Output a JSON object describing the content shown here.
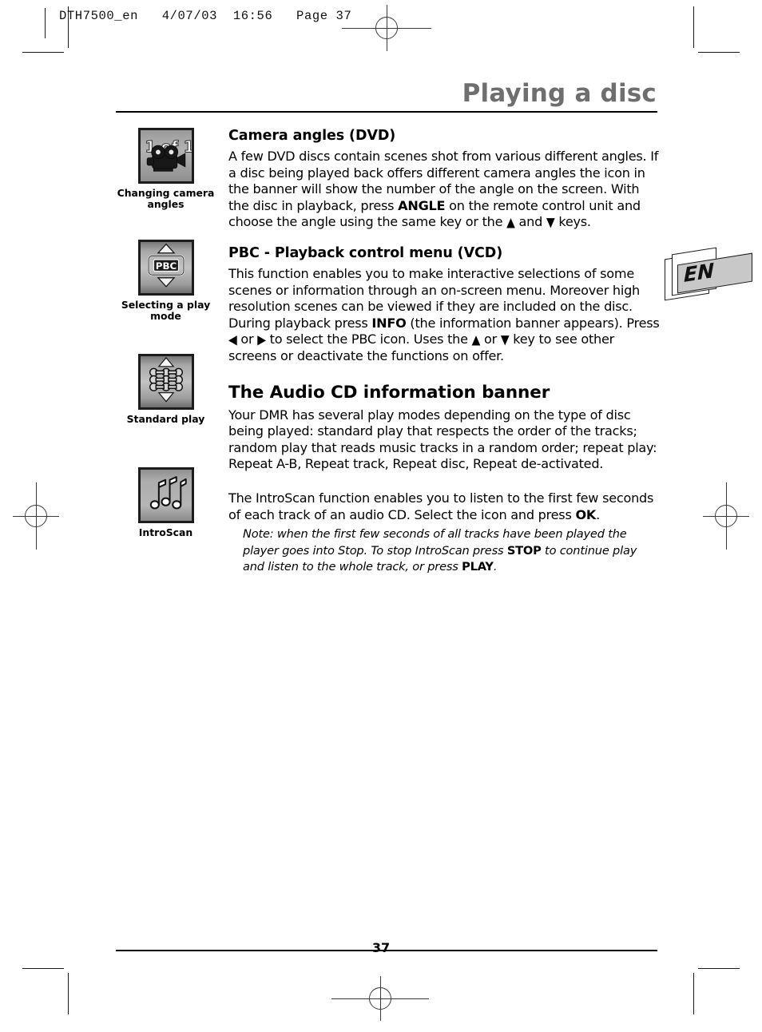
{
  "job_header": "DTH7500_en   4/07/03  16:56   Page 37",
  "title": "Playing a disc",
  "language_tab": "EN",
  "page_number": "37",
  "sidebar": {
    "items": [
      {
        "icon": "movie-camera-icon",
        "icon_text": "1 of 1",
        "caption": "Changing camera\nangles"
      },
      {
        "icon": "pbc-icon",
        "icon_text": "PBC",
        "caption": "Selecting a play\nmode"
      },
      {
        "icon": "standard-play-icon",
        "icon_text": "",
        "caption": "Standard play"
      },
      {
        "icon": "music-notes-icon",
        "icon_text": "",
        "caption": "IntroScan"
      }
    ]
  },
  "sections": [
    {
      "heading": "Camera angles (DVD)",
      "paragraph_parts": [
        {
          "t": "A few DVD discs contain scenes shot from various different angles. If a disc being played back offers different camera angles the icon in the banner will show the number of the angle on the screen. With the disc in playback, press ",
          "b": false
        },
        {
          "t": "ANGLE",
          "b": true
        },
        {
          "t": " on the remote control unit and choose the angle using the same key or the ",
          "b": false
        },
        {
          "t": "▲",
          "arrow": true
        },
        {
          "t": " and ",
          "b": false
        },
        {
          "t": "▼",
          "arrow": true
        },
        {
          "t": " keys.",
          "b": false
        }
      ]
    },
    {
      "heading": "PBC - Playback control menu (VCD)",
      "paragraph_parts": [
        {
          "t": "This function enables you to make interactive selections of some scenes or information through an on-screen menu. Moreover high resolution scenes can be viewed if they are included on the disc. During playback press ",
          "b": false
        },
        {
          "t": "INFO",
          "b": true
        },
        {
          "t": " (the information banner appears). Press ",
          "b": false
        },
        {
          "t": "◀",
          "arrow": true
        },
        {
          "t": " or ",
          "b": false
        },
        {
          "t": "▶",
          "arrow": true
        },
        {
          "t": " to select the PBC icon. Uses the ",
          "b": false
        },
        {
          "t": "▲",
          "arrow": true
        },
        {
          "t": " or ",
          "b": false
        },
        {
          "t": "▼",
          "arrow": true
        },
        {
          "t": " key to see other screens or deactivate the functions on offer.",
          "b": false
        }
      ]
    },
    {
      "heading": "The Audio CD information banner",
      "big": true,
      "paragraph_parts": [
        {
          "t": "Your DMR has several play modes depending on the type of disc being played: standard play that respects the order of the tracks; random play that reads music tracks in a random order; repeat play: Repeat A-B, Repeat track, Repeat disc, Repeat de-activated.",
          "b": false
        }
      ]
    }
  ],
  "introscan": {
    "paragraph_parts": [
      {
        "t": "The IntroScan function enables you to listen to the first few seconds of each track of an audio CD. Select the icon and press ",
        "b": false
      },
      {
        "t": "OK",
        "b": true
      },
      {
        "t": ".",
        "b": false
      }
    ],
    "note_parts": [
      {
        "t": "Note: when the first few seconds of all tracks have been played the player goes into Stop. To stop IntroScan press ",
        "b": false
      },
      {
        "t": "STOP",
        "b": true
      },
      {
        "t": " to continue play and listen to the whole track, or press ",
        "b": false
      },
      {
        "t": "PLAY",
        "b": true
      },
      {
        "t": ".",
        "b": false
      }
    ]
  },
  "colors": {
    "title_gray": "#6e6e6e",
    "icon_border": "#1c1c1c",
    "tab_fill": "#c8c8c8"
  }
}
